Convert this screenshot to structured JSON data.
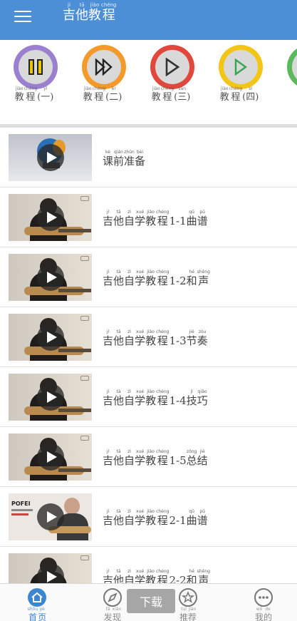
{
  "header": {
    "title": [
      {
        "py": "jí",
        "hz": "吉"
      },
      {
        "py": "tā",
        "hz": "他"
      },
      {
        "py": "jiào",
        "hz": "教"
      },
      {
        "py": "chéng",
        "hz": "程"
      }
    ]
  },
  "categories": [
    {
      "ring": "#9b7fd0",
      "color": "#222",
      "shape": "pause",
      "label": [
        {
          "py": "jiào",
          "hz": "教"
        },
        {
          "py": "chéng",
          "hz": "程"
        },
        {
          "py": "",
          "hz": "("
        },
        {
          "py": "yī",
          "hz": "一"
        },
        {
          "py": "",
          "hz": ")"
        }
      ]
    },
    {
      "ring": "#f39a2a",
      "color": "#222",
      "shape": "fastforward",
      "label": [
        {
          "py": "jiào",
          "hz": "教"
        },
        {
          "py": "chéng",
          "hz": "程"
        },
        {
          "py": "",
          "hz": "("
        },
        {
          "py": "èr",
          "hz": "二"
        },
        {
          "py": "",
          "hz": ")"
        }
      ]
    },
    {
      "ring": "#e0483e",
      "color": "#333",
      "shape": "play-outline",
      "label": [
        {
          "py": "jiào",
          "hz": "教"
        },
        {
          "py": "chéng",
          "hz": "程"
        },
        {
          "py": "",
          "hz": "("
        },
        {
          "py": "sān",
          "hz": "三"
        },
        {
          "py": "",
          "hz": ")"
        }
      ]
    },
    {
      "ring": "#f2c516",
      "color": "#3aa64c",
      "shape": "play-outline-green",
      "label": [
        {
          "py": "jiào",
          "hz": "教"
        },
        {
          "py": "chéng",
          "hz": "程"
        },
        {
          "py": "",
          "hz": "("
        },
        {
          "py": "sì",
          "hz": "四"
        },
        {
          "py": "",
          "hz": ")"
        }
      ]
    },
    {
      "ring": "#5cb85c",
      "color": "#333",
      "shape": "none",
      "label": [
        {
          "py": "jiào",
          "hz": "教"
        }
      ]
    }
  ],
  "lessons": [
    {
      "thumb": "intro",
      "title": [
        {
          "py": "kè",
          "hz": "课"
        },
        {
          "py": "qián",
          "hz": "前"
        },
        {
          "py": "zhǔn",
          "hz": "准"
        },
        {
          "py": "bèi",
          "hz": "备"
        }
      ]
    },
    {
      "thumb": "player",
      "title": [
        {
          "py": "jí",
          "hz": "吉"
        },
        {
          "py": "tā",
          "hz": "他"
        },
        {
          "py": "zì",
          "hz": "自"
        },
        {
          "py": "xué",
          "hz": "学"
        },
        {
          "py": "jiào",
          "hz": "教"
        },
        {
          "py": "chéng",
          "hz": "程"
        },
        {
          "py": "",
          "hz": "1-1"
        },
        {
          "py": "qǔ",
          "hz": "曲"
        },
        {
          "py": "pǔ",
          "hz": "谱"
        }
      ]
    },
    {
      "thumb": "player",
      "title": [
        {
          "py": "jí",
          "hz": "吉"
        },
        {
          "py": "tā",
          "hz": "他"
        },
        {
          "py": "zì",
          "hz": "自"
        },
        {
          "py": "xué",
          "hz": "学"
        },
        {
          "py": "jiào",
          "hz": "教"
        },
        {
          "py": "chéng",
          "hz": "程"
        },
        {
          "py": "",
          "hz": "1-2"
        },
        {
          "py": "hé",
          "hz": "和"
        },
        {
          "py": "shēng",
          "hz": "声"
        }
      ]
    },
    {
      "thumb": "player",
      "title": [
        {
          "py": "jí",
          "hz": "吉"
        },
        {
          "py": "tā",
          "hz": "他"
        },
        {
          "py": "zì",
          "hz": "自"
        },
        {
          "py": "xué",
          "hz": "学"
        },
        {
          "py": "jiào",
          "hz": "教"
        },
        {
          "py": "chéng",
          "hz": "程"
        },
        {
          "py": "",
          "hz": "1-3"
        },
        {
          "py": "jié",
          "hz": "节"
        },
        {
          "py": "zòu",
          "hz": "奏"
        }
      ]
    },
    {
      "thumb": "player",
      "title": [
        {
          "py": "jí",
          "hz": "吉"
        },
        {
          "py": "tā",
          "hz": "他"
        },
        {
          "py": "zì",
          "hz": "自"
        },
        {
          "py": "xué",
          "hz": "学"
        },
        {
          "py": "jiào",
          "hz": "教"
        },
        {
          "py": "chéng",
          "hz": "程"
        },
        {
          "py": "",
          "hz": "1-4"
        },
        {
          "py": "jì",
          "hz": "技"
        },
        {
          "py": "qiǎo",
          "hz": "巧"
        }
      ]
    },
    {
      "thumb": "player",
      "title": [
        {
          "py": "jí",
          "hz": "吉"
        },
        {
          "py": "tā",
          "hz": "他"
        },
        {
          "py": "zì",
          "hz": "自"
        },
        {
          "py": "xué",
          "hz": "学"
        },
        {
          "py": "jiào",
          "hz": "教"
        },
        {
          "py": "chéng",
          "hz": "程"
        },
        {
          "py": "",
          "hz": "1-5"
        },
        {
          "py": "zǒng",
          "hz": "总"
        },
        {
          "py": "jié",
          "hz": "结"
        }
      ]
    },
    {
      "thumb": "pofei",
      "brand": "POFEI",
      "title": [
        {
          "py": "jí",
          "hz": "吉"
        },
        {
          "py": "tā",
          "hz": "他"
        },
        {
          "py": "zì",
          "hz": "自"
        },
        {
          "py": "xué",
          "hz": "学"
        },
        {
          "py": "jiào",
          "hz": "教"
        },
        {
          "py": "chéng",
          "hz": "程"
        },
        {
          "py": "",
          "hz": "2-1"
        },
        {
          "py": "qǔ",
          "hz": "曲"
        },
        {
          "py": "pǔ",
          "hz": "谱"
        }
      ]
    },
    {
      "thumb": "player",
      "title": [
        {
          "py": "jí",
          "hz": "吉"
        },
        {
          "py": "tā",
          "hz": "他"
        },
        {
          "py": "zì",
          "hz": "自"
        },
        {
          "py": "xué",
          "hz": "学"
        },
        {
          "py": "jiào",
          "hz": "教"
        },
        {
          "py": "chéng",
          "hz": "程"
        },
        {
          "py": "",
          "hz": "2-2"
        },
        {
          "py": "hé",
          "hz": "和"
        },
        {
          "py": "shēng",
          "hz": "声"
        }
      ]
    }
  ],
  "tabs": [
    {
      "icon": "home-icon",
      "active": true,
      "label": [
        {
          "py": "shǒu",
          "hz": "首"
        },
        {
          "py": "yè",
          "hz": "页"
        }
      ]
    },
    {
      "icon": "compass-icon",
      "active": false,
      "label": [
        {
          "py": "fā",
          "hz": "发"
        },
        {
          "py": "xiàn",
          "hz": "现"
        }
      ]
    },
    {
      "icon": "star-icon",
      "active": false,
      "label": [
        {
          "py": "tuī",
          "hz": "推"
        },
        {
          "py": "jiàn",
          "hz": "荐"
        }
      ]
    },
    {
      "icon": "more-icon",
      "active": false,
      "label": [
        {
          "py": "wǒ",
          "hz": "我"
        },
        {
          "py": "de",
          "hz": "的"
        }
      ]
    }
  ],
  "toast": {
    "text": "下载"
  },
  "colors": {
    "accent": "#4d8fd6",
    "tab_active": "#3b86d1"
  }
}
